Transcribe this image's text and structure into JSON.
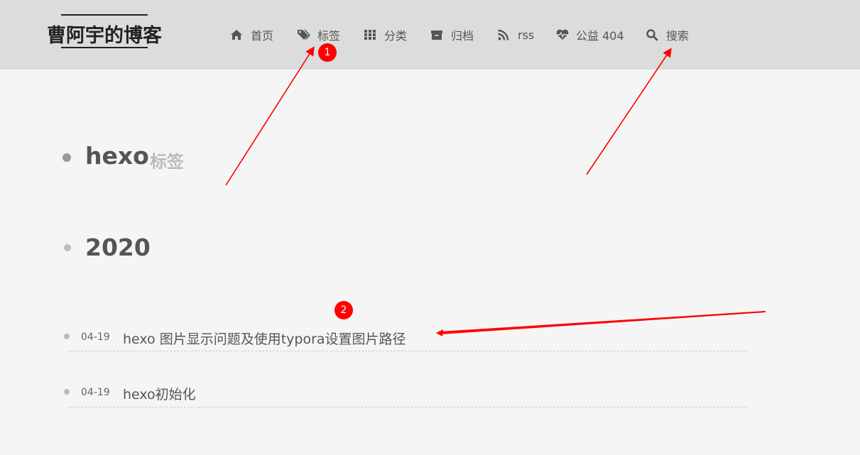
{
  "header": {
    "brand": "曹阿宇的博客",
    "nav": [
      {
        "label": "首页",
        "icon": "home-icon"
      },
      {
        "label": "标签",
        "icon": "tags-icon"
      },
      {
        "label": "分类",
        "icon": "grid-icon"
      },
      {
        "label": "归档",
        "icon": "archive-icon"
      },
      {
        "label": "rss",
        "icon": "rss-icon"
      },
      {
        "label": "公益 404",
        "icon": "heartbeat-icon"
      },
      {
        "label": "搜索",
        "icon": "search-icon"
      }
    ]
  },
  "main": {
    "tag_name": "hexo",
    "tag_suffix": "标签",
    "year": "2020",
    "posts": [
      {
        "date": "04-19",
        "title": "hexo 图片显示问题及使用typora设置图片路径"
      },
      {
        "date": "04-19",
        "title": "hexo初始化"
      }
    ]
  },
  "annotations": {
    "badge_1": "1",
    "badge_2": "2",
    "color": "#ff0000"
  },
  "colors": {
    "header_bg": "#dcdcdc",
    "page_bg": "#f5f5f5",
    "text": "#555555"
  }
}
